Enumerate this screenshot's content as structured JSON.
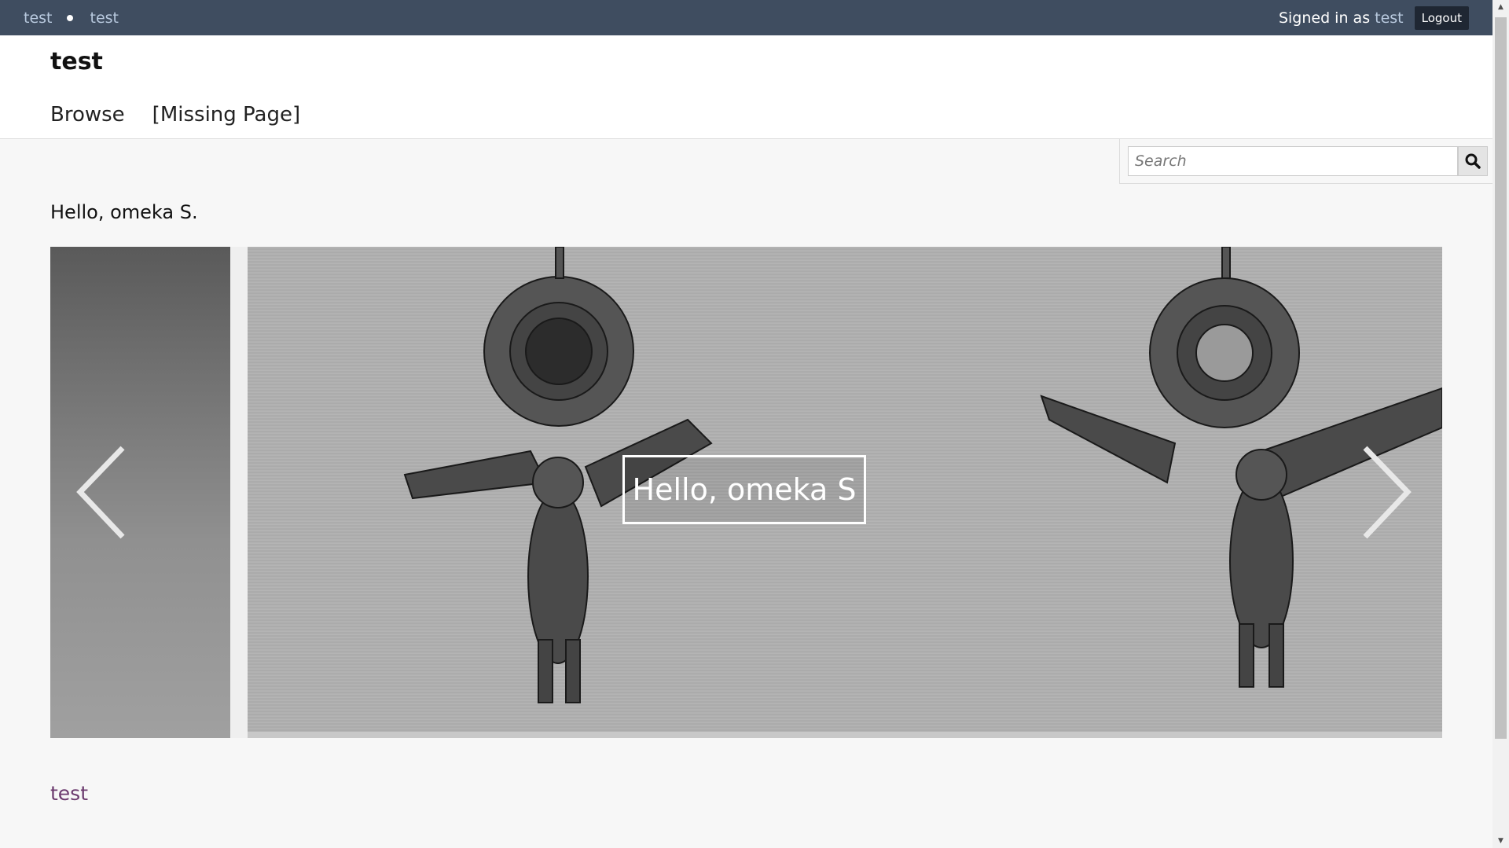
{
  "admin_bar": {
    "links": [
      "test",
      "test"
    ],
    "signed_in_prefix": "Signed in as",
    "user": "test",
    "logout_label": "Logout"
  },
  "header": {
    "site_title": "test",
    "nav": [
      "Browse",
      "[Missing Page]"
    ]
  },
  "search": {
    "placeholder": "Search",
    "icon": "search-icon"
  },
  "main": {
    "heading": "Hello, omeka S.",
    "carousel": {
      "caption": "Hello, omeka S",
      "prev_icon": "chevron-left-icon",
      "next_icon": "chevron-right-icon"
    },
    "footer_link": "test"
  },
  "colors": {
    "admin_bar": "#3f4d60",
    "link": "#b8c9de",
    "footer_link": "#6b3a6e"
  }
}
